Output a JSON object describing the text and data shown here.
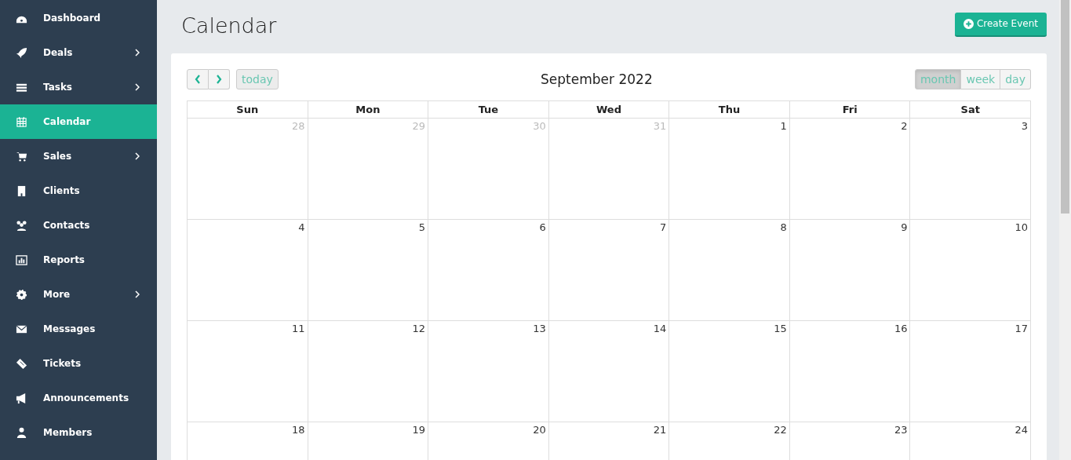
{
  "sidebar": {
    "items": [
      {
        "label": "Dashboard",
        "selected": false,
        "has_submenu": false
      },
      {
        "label": "Deals",
        "selected": false,
        "has_submenu": true
      },
      {
        "label": "Tasks",
        "selected": false,
        "has_submenu": true
      },
      {
        "label": "Calendar",
        "selected": true,
        "has_submenu": false
      },
      {
        "label": "Sales",
        "selected": false,
        "has_submenu": true
      },
      {
        "label": "Clients",
        "selected": false,
        "has_submenu": false
      },
      {
        "label": "Contacts",
        "selected": false,
        "has_submenu": false
      },
      {
        "label": "Reports",
        "selected": false,
        "has_submenu": false
      },
      {
        "label": "More",
        "selected": false,
        "has_submenu": true
      },
      {
        "label": "Messages",
        "selected": false,
        "has_submenu": false
      },
      {
        "label": "Tickets",
        "selected": false,
        "has_submenu": false
      },
      {
        "label": "Announcements",
        "selected": false,
        "has_submenu": false
      },
      {
        "label": "Members",
        "selected": false,
        "has_submenu": false
      }
    ]
  },
  "page": {
    "title": "Calendar",
    "create_button": "Create Event"
  },
  "calendar": {
    "title": "September 2022",
    "today_button": "today",
    "views": [
      {
        "label": "month",
        "selected": true
      },
      {
        "label": "week",
        "selected": false
      },
      {
        "label": "day",
        "selected": false
      }
    ],
    "weekdays": [
      "Sun",
      "Mon",
      "Tue",
      "Wed",
      "Thu",
      "Fri",
      "Sat"
    ],
    "weeks": [
      [
        {
          "day": "28",
          "other_month": true
        },
        {
          "day": "29",
          "other_month": true
        },
        {
          "day": "30",
          "other_month": true
        },
        {
          "day": "31",
          "other_month": true
        },
        {
          "day": "1",
          "other_month": false
        },
        {
          "day": "2",
          "other_month": false
        },
        {
          "day": "3",
          "other_month": false
        }
      ],
      [
        {
          "day": "4",
          "other_month": false
        },
        {
          "day": "5",
          "other_month": false
        },
        {
          "day": "6",
          "other_month": false
        },
        {
          "day": "7",
          "other_month": false
        },
        {
          "day": "8",
          "other_month": false
        },
        {
          "day": "9",
          "other_month": false
        },
        {
          "day": "10",
          "other_month": false
        }
      ],
      [
        {
          "day": "11",
          "other_month": false
        },
        {
          "day": "12",
          "other_month": false
        },
        {
          "day": "13",
          "other_month": false
        },
        {
          "day": "14",
          "other_month": false
        },
        {
          "day": "15",
          "other_month": false
        },
        {
          "day": "16",
          "other_month": false
        },
        {
          "day": "17",
          "other_month": false
        }
      ],
      [
        {
          "day": "18",
          "other_month": false
        },
        {
          "day": "19",
          "other_month": false
        },
        {
          "day": "20",
          "other_month": false
        },
        {
          "day": "21",
          "other_month": false
        },
        {
          "day": "22",
          "other_month": false
        },
        {
          "day": "23",
          "other_month": false
        },
        {
          "day": "24",
          "other_month": false
        }
      ]
    ]
  }
}
